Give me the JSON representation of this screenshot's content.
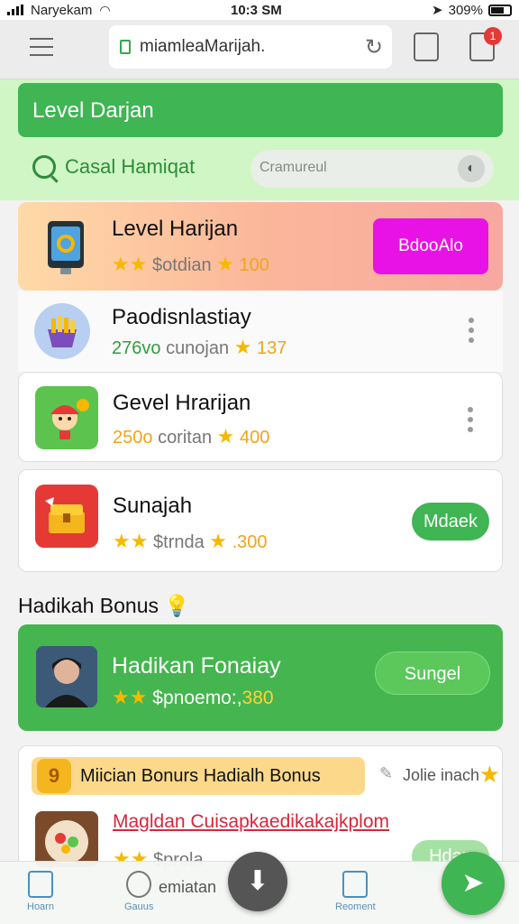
{
  "status_bar": {
    "carrier": "Naryekam",
    "time": "10:3 SM",
    "battery": "309%"
  },
  "browser": {
    "url": "miamleaMarijah.",
    "notification_count": "1"
  },
  "header": {
    "banner_title": "Level Darjan",
    "category_label": "Casal Hamiqat",
    "search_placeholder": "Cramureul"
  },
  "games": [
    {
      "title": "Level Harijan",
      "meta_prefix": "",
      "meta_text": "$otdian",
      "stars": "★★",
      "score": "100",
      "action_label": "BdooAlo",
      "icon": "tablet-app-icon"
    },
    {
      "title": "Paodisnlastiay",
      "meta_prefix": "276vo",
      "meta_text": "cunojan",
      "stars": "★",
      "score": "137",
      "icon": "fries-basket-icon"
    },
    {
      "title": "Gevel Hrarijan",
      "meta_prefix": "250o",
      "meta_text": "coritan",
      "stars": "★",
      "score": "400",
      "icon": "mascot-character-icon"
    },
    {
      "title": "Sunajah",
      "meta_prefix": "",
      "meta_text": "$trnda",
      "stars": "★★",
      "score": ".300",
      "action_label": "Mdaek",
      "icon": "treasure-chest-icon"
    }
  ],
  "bonus_section": {
    "title": "Hadikah Bonus",
    "card": {
      "title": "Hadikan Fonaiay",
      "stars": "★★",
      "meta_text": "$pnoemo:,",
      "score": "380",
      "action_label": "Sungel"
    }
  },
  "promo": {
    "pill_label": "Miician Bonurs Hadialh Bonus",
    "coin_glyph": "9",
    "side_label": "Jolie inach",
    "link_text": "Magldan Cuisapkaedikakajkplom",
    "stars": "★★",
    "meta_text": "$prola",
    "action_label": "Hdan"
  },
  "bottom_nav": {
    "home_label": "Hoarn",
    "games_label": "Gauus",
    "center_text": "emiatan",
    "recent_label": "Reoment"
  },
  "colors": {
    "accent_green": "#3fb553",
    "magenta_button": "#e812e6",
    "star_gold": "#f6b800"
  }
}
